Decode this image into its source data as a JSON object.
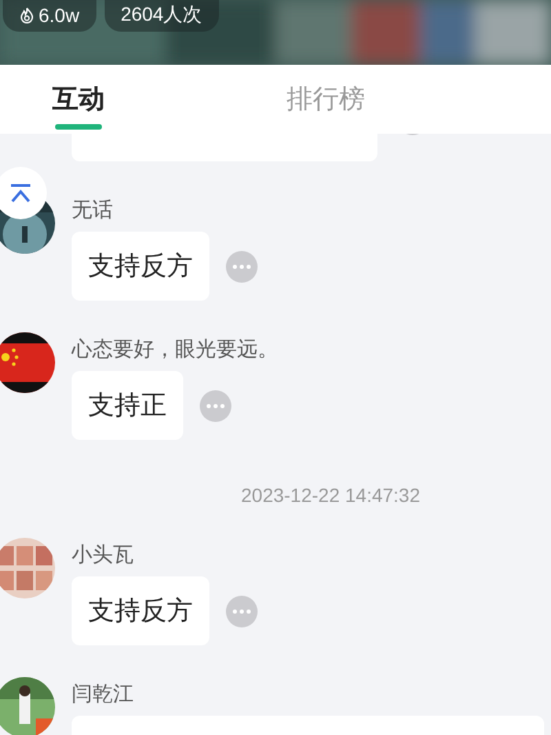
{
  "header": {
    "stats": [
      {
        "kind": "heat",
        "text": "6.0w"
      },
      {
        "kind": "count",
        "text": "2604人次"
      }
    ]
  },
  "tabs": [
    {
      "label": "互动",
      "selected": true
    },
    {
      "label": "排行榜",
      "selected": false
    }
  ],
  "feed": [
    {
      "kind": "partial_bubble"
    },
    {
      "kind": "message",
      "name": "无话",
      "text": "支持反方"
    },
    {
      "kind": "message",
      "name": "心态要好，眼光要远。",
      "text": "支持正"
    },
    {
      "kind": "time",
      "text": "2023-12-22 14:47:32"
    },
    {
      "kind": "message",
      "name": "小头瓦",
      "text": "支持反方"
    },
    {
      "kind": "partial_message",
      "name": "闫乾江"
    }
  ]
}
